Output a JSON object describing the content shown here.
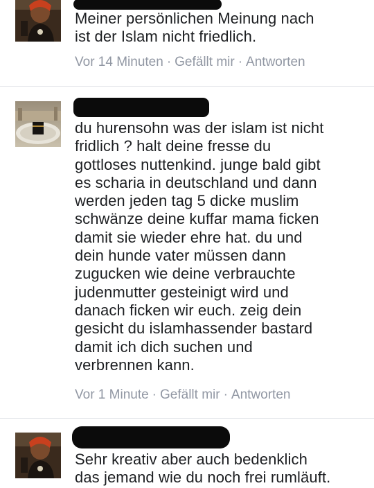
{
  "comments": [
    {
      "text_lines": [
        "Meiner persönlichen Meinung nach",
        "ist der  Islam nicht friedlich."
      ],
      "time": "Vor 14 Minuten",
      "like": "Gefällt mir",
      "reply": "Antworten"
    },
    {
      "text_lines": [
        "du hurensohn was der islam ist nicht",
        "fridlich ? halt deine fresse du",
        "gottloses nuttenkind. junge bald gibt",
        "es scharia in deutschland und dann",
        "werden jeden tag 5 dicke muslim",
        "schwänze deine kuffar mama ficken",
        "damit sie wieder ehre hat. du und",
        "dein hunde vater müssen dann",
        "zugucken wie deine verbrauchte",
        "judenmutter gesteinigt wird und",
        "danach ficken wir euch. zeig dein",
        "gesicht du islamhassender bastard",
        "damit ich dich suchen und",
        "verbrennen kann."
      ],
      "time": "Vor 1 Minute",
      "like": "Gefällt mir",
      "reply": "Antworten"
    },
    {
      "text_lines": [
        "Sehr kreativ aber auch bedenklich",
        "das jemand wie du noch frei rumläuft."
      ]
    }
  ],
  "separator": "·",
  "icons": {
    "avatar_1": "profile-photo-person",
    "avatar_2": "profile-photo-kaaba",
    "avatar_3": "profile-photo-person",
    "redaction": "redacted-name-bar"
  },
  "colors": {
    "text": "#1c1e21",
    "meta": "#9197a3",
    "divider": "#e4e6ea",
    "redaction": "#0b0b0b"
  }
}
